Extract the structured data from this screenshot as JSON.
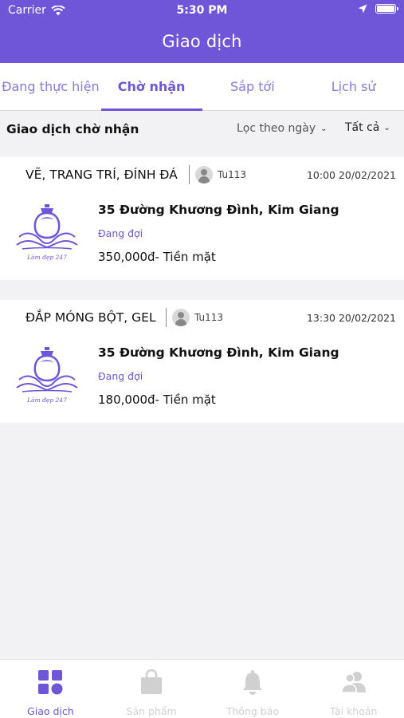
{
  "status_bar": {
    "carrier": "Carrier",
    "time": "5:30 PM"
  },
  "header": {
    "title": "Giao dịch"
  },
  "tabs": [
    {
      "label": "Đang thực hiện"
    },
    {
      "label": "Chờ nhận",
      "active": true
    },
    {
      "label": "Sắp tới"
    },
    {
      "label": "Lịch sử"
    }
  ],
  "filter": {
    "section_title": "Giao dịch chờ nhận",
    "date_filter": "Lọc theo ngày",
    "status_filter": "Tất cả"
  },
  "transactions": [
    {
      "service": "VẼ, TRANG TRÍ, ĐÍNH ĐÁ",
      "user": "Tu113",
      "time": "10:00 20/02/2021",
      "address": "35 Đường Khương Đình, Kim Giang",
      "status": "Đang đợi",
      "price": "350,000đ- Tiền mặt"
    },
    {
      "service": "ĐẮP MÓNG BỘT, GEL",
      "user": "Tu113",
      "time": "13:30 20/02/2021",
      "address": "35 Đường Khương Đình, Kim Giang",
      "status": "Đang đợi",
      "price": "180,000đ- Tiền mặt"
    }
  ],
  "bottom_nav": [
    {
      "label": "Giao dịch",
      "icon": "grid-icon",
      "active": true
    },
    {
      "label": "Sản phẩm",
      "icon": "shopping-bag-icon"
    },
    {
      "label": "Thông báo",
      "icon": "bell-icon"
    },
    {
      "label": "Tài khoản",
      "icon": "users-icon"
    }
  ],
  "colors": {
    "accent": "#6f55d8",
    "inactive": "#d0d0d0",
    "background": "#f2f2f4"
  }
}
